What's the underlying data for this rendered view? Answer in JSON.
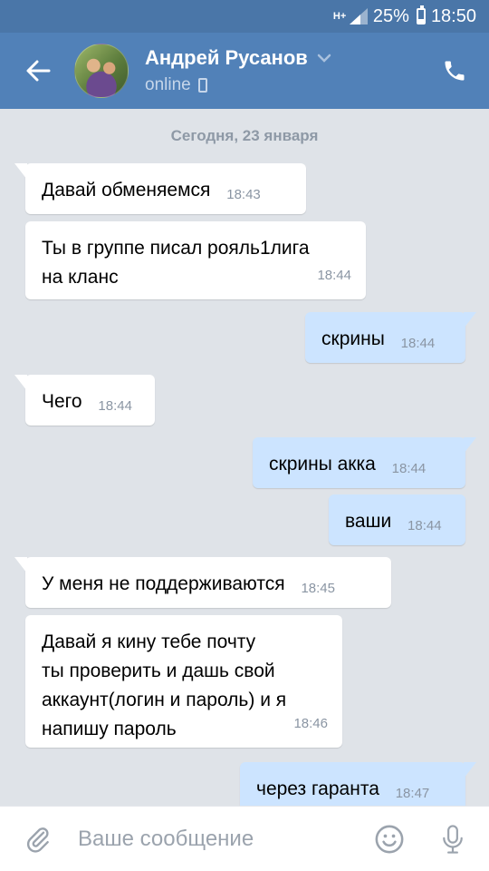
{
  "status_bar": {
    "network": "H+",
    "battery": "25%",
    "time": "18:50"
  },
  "header": {
    "name": "Андрей Русанов",
    "status": "online"
  },
  "date_separator": "Сегодня, 23 января",
  "messages": [
    {
      "dir": "in",
      "text": "Давай обменяемся",
      "time": "18:43"
    },
    {
      "dir": "in",
      "text": "Ты в группе писал рояль1лига\nна кланс",
      "time": "18:44"
    },
    {
      "dir": "out",
      "text": "скрины",
      "time": "18:44"
    },
    {
      "dir": "in",
      "text": "Чего",
      "time": "18:44"
    },
    {
      "dir": "out",
      "text": "скрины акка",
      "time": "18:44"
    },
    {
      "dir": "out",
      "text": "ваши",
      "time": "18:44"
    },
    {
      "dir": "in",
      "text": "У меня не поддерживаются",
      "time": "18:45"
    },
    {
      "dir": "in",
      "text": "Давай я кину тебе почту\nты проверить и дашь свой\nаккаунт(логин и пароль) и я\nнапишу пароль",
      "time": "18:46"
    },
    {
      "dir": "out",
      "text": "через гаранта",
      "time": "18:47"
    }
  ],
  "composer": {
    "placeholder": "Ваше сообщение"
  },
  "colors": {
    "header": "#5181b8",
    "status_bar": "#4a76a8",
    "background": "#dfe3e8",
    "incoming": "#ffffff",
    "outgoing": "#cce4ff"
  },
  "icons": [
    "back-arrow-icon",
    "phone-icon",
    "chevron-down-icon",
    "mobile-icon",
    "paperclip-icon",
    "smiley-icon",
    "microphone-icon"
  ]
}
